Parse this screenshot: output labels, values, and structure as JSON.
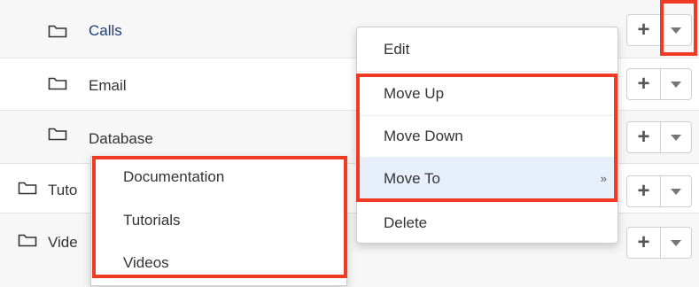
{
  "colors": {
    "link": "#1d3f78",
    "text": "#333333",
    "highlight": "#ef3a24",
    "active_menu_bg": "#e7f0fa",
    "alt_row_bg": "#f7f7f7"
  },
  "rows": [
    {
      "label": "Calls",
      "icon": "folder-icon"
    },
    {
      "label": "Email",
      "icon": "folder-icon"
    },
    {
      "label": "Database",
      "icon": "folder-icon"
    },
    {
      "label": "Tuto",
      "icon": "folder-icon"
    },
    {
      "label": "Vide",
      "icon": "folder-icon"
    }
  ],
  "row_actions": {
    "add_symbol": "+",
    "add_icon": "plus-icon",
    "caret_icon": "caret-down-icon"
  },
  "dropdown": {
    "items": [
      {
        "label": "Edit"
      },
      {
        "label": "Move Up"
      },
      {
        "label": "Move Down"
      },
      {
        "label": "Move To",
        "submenu_arrow": "»"
      },
      {
        "label": "Delete"
      }
    ]
  },
  "submenu": {
    "items": [
      {
        "label": "Documentation"
      },
      {
        "label": "Tutorials"
      },
      {
        "label": "Videos"
      }
    ]
  }
}
